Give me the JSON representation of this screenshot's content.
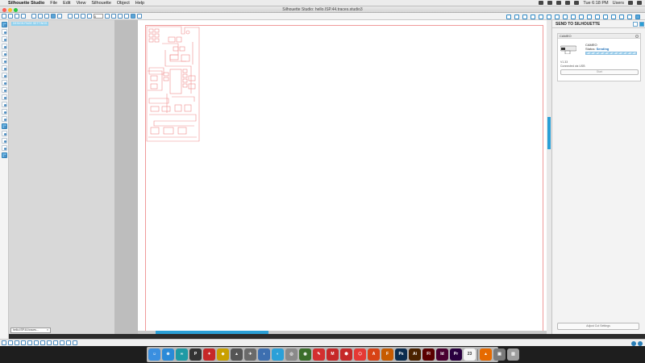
{
  "menubar": {
    "app": "Silhouette Studio",
    "items": [
      "File",
      "Edit",
      "View",
      "Silhouette",
      "Object",
      "Help"
    ],
    "clock": "Tue 6:18 PM",
    "user": "Users"
  },
  "window": {
    "title": "Silhouette Studio: hello.ISP.44.traces.studio3"
  },
  "toolbar": {
    "zoom_label": "0"
  },
  "workarea": {
    "tip_label": "DESIGN PAGE SETTINGS",
    "doc_tab": "hello.ISP.44.traces...",
    "doc_tab_close": "×"
  },
  "send_panel": {
    "title": "SEND TO SILHOUETTE",
    "device_card_title": "CAMEO",
    "device_name": "CAMEO",
    "status_label": "Status:",
    "status_value": "Sending",
    "progress": 1.0,
    "version": "V1.33",
    "connected": "Connected via USB",
    "start_label": "Start",
    "adjust_label": "Adjust Cut Settings"
  },
  "dock": {
    "icons": [
      {
        "name": "finder",
        "color": "#3a8fe0",
        "glyph": "☺"
      },
      {
        "name": "safari",
        "color": "#2a8ad8",
        "glyph": "⊕"
      },
      {
        "name": "arduino",
        "color": "#1f9aa5",
        "glyph": "∞"
      },
      {
        "name": "pixelmator",
        "color": "#333333",
        "glyph": "P"
      },
      {
        "name": "fabmodules",
        "color": "#c62828",
        "glyph": "✦"
      },
      {
        "name": "eagle",
        "color": "#c9a000",
        "glyph": "◆"
      },
      {
        "name": "terminal",
        "color": "#555555",
        "glyph": "▲"
      },
      {
        "name": "wunderlist",
        "color": "#6a6a6a",
        "glyph": "✈"
      },
      {
        "name": "kicad",
        "color": "#3d6fb0",
        "glyph": "◗"
      },
      {
        "name": "chrome",
        "color": "#2aa0d8",
        "glyph": "◐"
      },
      {
        "name": "silhouette",
        "color": "#8a8a8a",
        "glyph": "◎"
      },
      {
        "name": "sketchbook",
        "color": "#3b6e2b",
        "glyph": "◉"
      },
      {
        "name": "inkscape",
        "color": "#d32f2f",
        "glyph": "✎"
      },
      {
        "name": "makerbot",
        "color": "#c62828",
        "glyph": "M"
      },
      {
        "name": "sketchup",
        "color": "#c62828",
        "glyph": "⬢"
      },
      {
        "name": "sketchup-layout",
        "color": "#e53935",
        "glyph": "⬡"
      },
      {
        "name": "autodesk",
        "color": "#d84315",
        "glyph": "A"
      },
      {
        "name": "fusion",
        "color": "#c75b00",
        "glyph": "F"
      },
      {
        "name": "photoshop",
        "color": "#0b2d4f",
        "glyph": "Ps"
      },
      {
        "name": "illustrator",
        "color": "#4a2200",
        "glyph": "Ai"
      },
      {
        "name": "flash",
        "color": "#5a0000",
        "glyph": "Fl"
      },
      {
        "name": "indesign",
        "color": "#4a0030",
        "glyph": "Id"
      },
      {
        "name": "premiere",
        "color": "#2a003f",
        "glyph": "Pr"
      },
      {
        "name": "calendar",
        "color": "#f5f5f5",
        "glyph": "23"
      },
      {
        "name": "vlc",
        "color": "#e66a00",
        "glyph": "▲"
      },
      {
        "name": "preview",
        "color": "#7a7a7a",
        "glyph": "▣"
      },
      {
        "name": "trash",
        "color": "#9e9e9e",
        "glyph": "▥"
      }
    ]
  }
}
